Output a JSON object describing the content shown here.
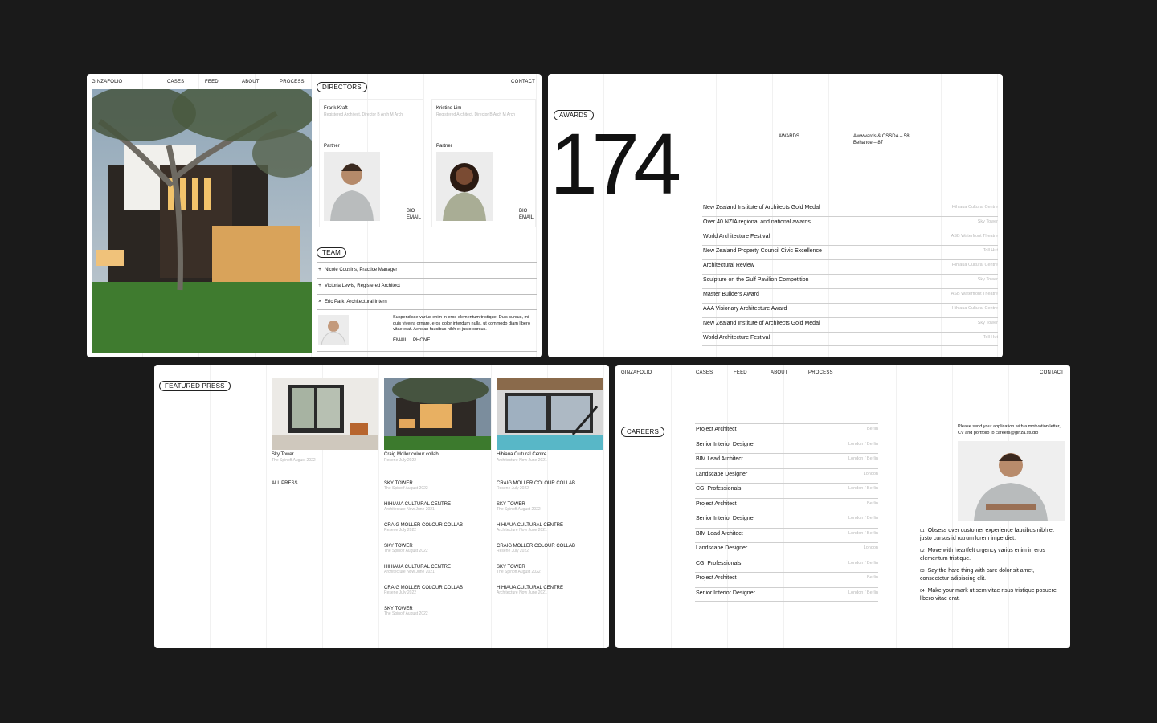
{
  "card1": {
    "brand": "GINZAFOLIO",
    "nav": [
      "CASES",
      "FEED",
      "ABOUT",
      "PROCESS"
    ],
    "contact": "CONTACT",
    "directors_pill": "DIRECTORS",
    "directors": [
      {
        "name": "Frank Kraft",
        "title": "Registered Architect, Director B Arch M Arch",
        "role": "Partner",
        "links": [
          "BIO",
          "EMAIL"
        ]
      },
      {
        "name": "Kristine Lim",
        "title": "Registered Architect, Director B Arch M Arch",
        "role": "Partner",
        "links": [
          "BIO",
          "EMAIL"
        ]
      }
    ],
    "team_pill": "TEAM",
    "team": [
      "Nicole Cousins, Practice Manager",
      "Victoria Lewis, Registered Architect",
      "Eric Park, Architectural Intern"
    ],
    "bio": "Suspendisse varius enim in eros elementum tristique. Duis cursus, mi quis viverra ornare, eros dolor interdum nulla, ut commodo diam libero vitae erat. Aenean faucibus nibh et justo cursus.",
    "bio_links": [
      "EMAIL",
      "PHONE"
    ]
  },
  "card2": {
    "awards_pill": "AWARDS",
    "count": "174",
    "awards_label": "AWARDS",
    "summary": [
      "Awwwards & CSSDA – 58",
      "Behance – 87"
    ],
    "awards": [
      {
        "name": "New Zealand Institute of Architects Gold Medal",
        "place": "Hihiaua Cultural Centre"
      },
      {
        "name": "Over 40 NZIA regional and national awards",
        "place": "Sky Tower"
      },
      {
        "name": "World Architecture Festival",
        "place": "ASB Waterfront Theatre"
      },
      {
        "name": "New Zealand Property Council Civic Excellence",
        "place": "Toll Hut"
      },
      {
        "name": "Architectural Review",
        "place": "Hihiaua Cultural Centre"
      },
      {
        "name": "Sculpture on the Gulf Pavilion Competition",
        "place": "Sky Tower"
      },
      {
        "name": "Master Builders Award",
        "place": "ASB Waterfront Theatre"
      },
      {
        "name": "AAA Visionary Architecture Award",
        "place": "Hihiaua Cultural Centre"
      },
      {
        "name": "New Zealand Institute of Architects Gold Medal",
        "place": "Sky Tower"
      },
      {
        "name": "World Architecture Festival",
        "place": "Toll Hut"
      }
    ]
  },
  "card3": {
    "press_pill": "FEATURED PRESS",
    "featured": [
      {
        "title": "Sky Tower",
        "sub": "The Spinoff August 2022"
      },
      {
        "title": "Craig Moller colour collab",
        "sub": "Resene July 2022"
      },
      {
        "title": "Hihiaua Cultural Centre",
        "sub": "Architecture Now June 2021"
      }
    ],
    "all_press": "ALL PRESS",
    "col1": [
      {
        "title": "SKY TOWER",
        "sub": "The Spinoff August 2022"
      },
      {
        "title": "HIHIAUA CULTURAL CENTRE",
        "sub": "Architecture Now June 2021"
      },
      {
        "title": "CRAIG MOLLER COLOUR COLLAB",
        "sub": "Resene July 2022"
      },
      {
        "title": "SKY TOWER",
        "sub": "The Spinoff August 2022"
      },
      {
        "title": "HIHIAUA CULTURAL CENTRE",
        "sub": "Architecture Now June 2021"
      },
      {
        "title": "CRAIG MOLLER COLOUR COLLAB",
        "sub": "Resene July 2022"
      },
      {
        "title": "SKY TOWER",
        "sub": "The Spinoff August 2022"
      }
    ],
    "col2": [
      {
        "title": "CRAIG MOLLER COLOUR COLLAB",
        "sub": "Resene July 2022"
      },
      {
        "title": "SKY TOWER",
        "sub": "The Spinoff August 2022"
      },
      {
        "title": "HIHIAUA CULTURAL CENTRE",
        "sub": "Architecture Now June 2021"
      },
      {
        "title": "CRAIG MOLLER COLOUR COLLAB",
        "sub": "Resene July 2022"
      },
      {
        "title": "SKY TOWER",
        "sub": "The Spinoff August 2022"
      },
      {
        "title": "HIHIAUA CULTURAL CENTRE",
        "sub": "Architecture Now June 2021"
      }
    ]
  },
  "card4": {
    "brand": "GINZAFOLIO",
    "nav": [
      "CASES",
      "FEED",
      "ABOUT",
      "PROCESS"
    ],
    "contact": "CONTACT",
    "careers_pill": "CAREERS",
    "jobs": [
      {
        "title": "Project Architect",
        "loc": "Berlin"
      },
      {
        "title": "Senior Interior Designer",
        "loc": "London / Berlin"
      },
      {
        "title": "BIM Lead Architect",
        "loc": "London / Berlin"
      },
      {
        "title": "Landscape Designer",
        "loc": "London"
      },
      {
        "title": "CGI Professionals",
        "loc": "London / Berlin"
      },
      {
        "title": "Project Architect",
        "loc": "Berlin"
      },
      {
        "title": "Senior Interior Designer",
        "loc": "London / Berlin"
      },
      {
        "title": "BIM Lead Architect",
        "loc": "London / Berlin"
      },
      {
        "title": "Landscape Designer",
        "loc": "London"
      },
      {
        "title": "CGI Professionals",
        "loc": "London / Berlin"
      },
      {
        "title": "Project Architect",
        "loc": "Berlin"
      },
      {
        "title": "Senior Interior Designer",
        "loc": "London / Berlin"
      }
    ],
    "apply_note": "Please send your application with a motivation letter, CV and portfolio to careers@ginza.studio",
    "points": [
      {
        "n": "01",
        "text": "Obsess over customer experience faucibus nibh et justo cursus id rutrum lorem imperdiet."
      },
      {
        "n": "02",
        "text": "Move with heartfelt urgency  varius enim in eros elementum tristique."
      },
      {
        "n": "03",
        "text": "Say the hard thing with care dolor sit amet, consectetur adipiscing elit."
      },
      {
        "n": "04",
        "text": "Make your mark ut sem vitae risus tristique posuere libero vitae erat."
      }
    ]
  },
  "icons": {
    "plus": "plus-icon"
  }
}
